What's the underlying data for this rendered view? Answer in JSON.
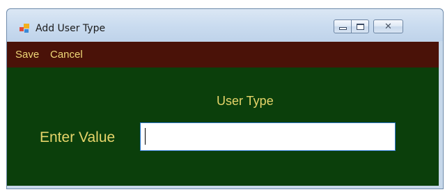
{
  "window": {
    "title": "Add User Type",
    "controls": {
      "minimize_icon": "minimize-icon",
      "maximize_icon": "maximize-icon",
      "close_icon": "close-icon"
    }
  },
  "menu": {
    "save_label": "Save",
    "cancel_label": "Cancel"
  },
  "form": {
    "heading": "User Type",
    "value_label": "Enter Value",
    "value_input": {
      "value": "",
      "placeholder": ""
    }
  },
  "colors": {
    "menubar_bg": "#4a1208",
    "content_bg": "#0b3f0b",
    "text_accent": "#e6d56a",
    "input_border": "#2b78d0"
  }
}
